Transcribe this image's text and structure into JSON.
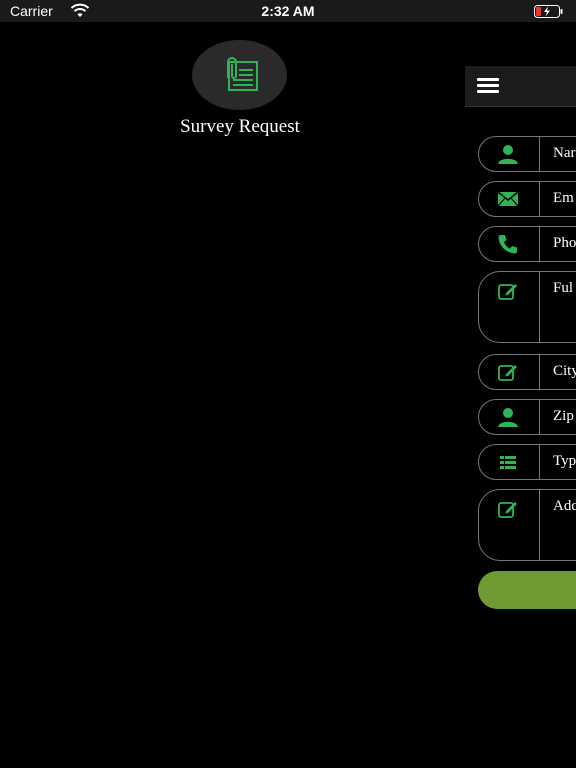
{
  "status_bar": {
    "carrier": "Carrier",
    "time": "2:32 AM"
  },
  "header": {
    "title": "Survey Request",
    "logo_icon": "document-clip-icon"
  },
  "form": {
    "fields": [
      {
        "label": "Nar",
        "icon": "person-icon"
      },
      {
        "label": "Em",
        "icon": "envelope-icon"
      },
      {
        "label": "Pho",
        "icon": "phone-icon"
      },
      {
        "label": "Ful",
        "icon": "edit-icon"
      },
      {
        "label": "City",
        "icon": "edit-icon"
      },
      {
        "label": "Zip",
        "icon": "person-icon"
      },
      {
        "label": "Typ",
        "icon": "list-icon"
      },
      {
        "label": "Add",
        "icon": "edit-icon"
      }
    ]
  },
  "colors": {
    "accent_green": "#2fb457",
    "submit_green": "#6e9a31",
    "background": "#000000"
  }
}
